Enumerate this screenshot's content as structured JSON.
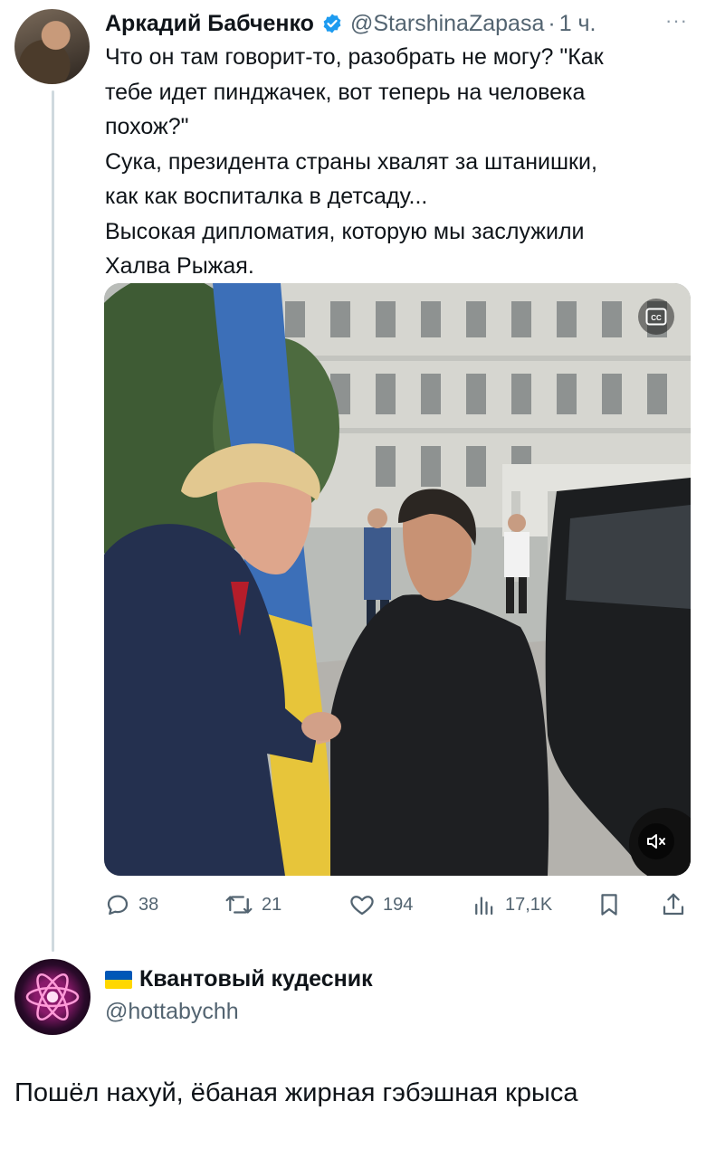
{
  "tweet": {
    "author_name": "Аркадий Бабченко",
    "handle": "@StarshinaZapasa",
    "separator": "·",
    "time": "1 ч.",
    "more": "···",
    "lines": [
      "Что он там говорит-то, разобрать не могу? \"Как",
      "тебе идет пинджачек, вот теперь на человека",
      "похож?\"",
      "Сука, президента страны хвалят за штанишки,",
      "как как воспиталка в детсаду...",
      "Высокая дипломатия, которую мы заслужили",
      "Халва Рыжая."
    ],
    "actions": {
      "replies": "38",
      "retweets": "21",
      "likes": "194",
      "views": "17,1K"
    }
  },
  "reply": {
    "author_name": "Квантовый кудесник",
    "handle": "@hottabychh",
    "text": "Пошёл нахуй, ёбаная жирная гэбэшная крыса"
  },
  "colors": {
    "text": "#0f1419",
    "muted": "#536471",
    "verified": "#1d9bf0",
    "thread_line": "#cfd9de",
    "flag_blue": "#0057b7",
    "flag_yellow": "#ffd700"
  },
  "icons": {
    "verified": "verified-badge-icon",
    "reply": "reply-icon",
    "retweet": "retweet-icon",
    "like": "heart-icon",
    "views": "views-icon",
    "bookmark": "bookmark-icon",
    "share": "share-icon",
    "captions": "captions-icon",
    "mute": "mute-icon"
  }
}
